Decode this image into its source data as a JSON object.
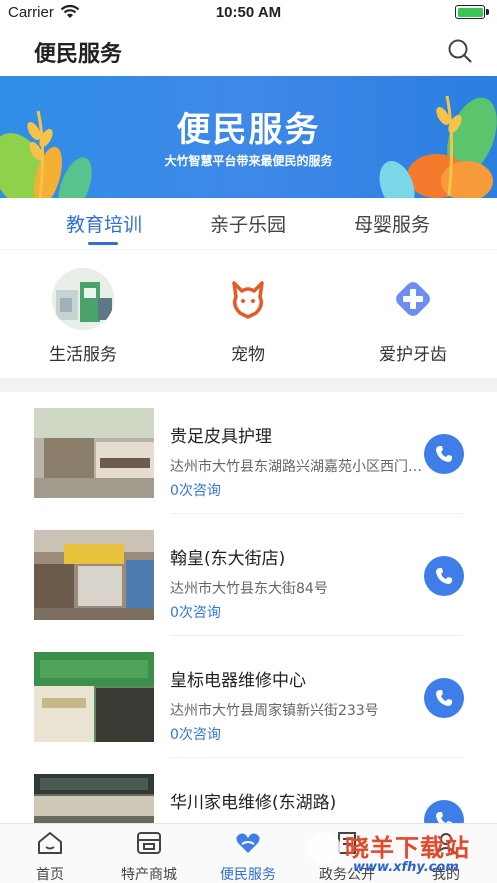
{
  "status_bar": {
    "carrier": "Carrier",
    "time": "10:50 AM",
    "battery_percent": 100
  },
  "nav": {
    "title": "便民服务",
    "search_icon": "search-icon"
  },
  "banner": {
    "title": "便民服务",
    "subtitle": "大竹智慧平台带来最便民的服务"
  },
  "tabs": [
    {
      "label": "教育培训",
      "active": true
    },
    {
      "label": "亲子乐园",
      "active": false
    },
    {
      "label": "母婴服务",
      "active": false
    }
  ],
  "services": [
    {
      "label": "生活服务",
      "icon": "store-photo-icon"
    },
    {
      "label": "宠物",
      "icon": "pet-icon"
    },
    {
      "label": "爱护牙齿",
      "icon": "medical-cross-icon"
    }
  ],
  "list": [
    {
      "name": "贵足皮具护理",
      "address": "达州市大竹县东湖路兴湖嘉苑小区西门第二个门市",
      "consult": "0次咨询"
    },
    {
      "name": "翰皇(东大街店)",
      "address": "达州市大竹县东大街84号",
      "consult": "0次咨询"
    },
    {
      "name": "皇标电器维修中心",
      "address": "达州市大竹县周家镇新兴街233号",
      "consult": "0次咨询"
    },
    {
      "name": "华川家电维修(东湖路)",
      "address": "",
      "consult": ""
    }
  ],
  "tabbar": [
    {
      "label": "首页",
      "icon": "home-icon",
      "active": false
    },
    {
      "label": "特产商城",
      "icon": "shop-icon",
      "active": false
    },
    {
      "label": "便民服务",
      "icon": "heart-hands-icon",
      "active": true
    },
    {
      "label": "政务公开",
      "icon": "document-icon",
      "active": false
    },
    {
      "label": "我的",
      "icon": "user-icon",
      "active": false
    }
  ],
  "watermark": {
    "text": "晓羊下载站",
    "url": "www.xfhy.com"
  },
  "colors": {
    "accent": "#2f6fd6",
    "phone": "#3f7ee8",
    "banner": "#2f8ee6",
    "pet": "#e55a2b",
    "cross": "#6d8df0"
  }
}
